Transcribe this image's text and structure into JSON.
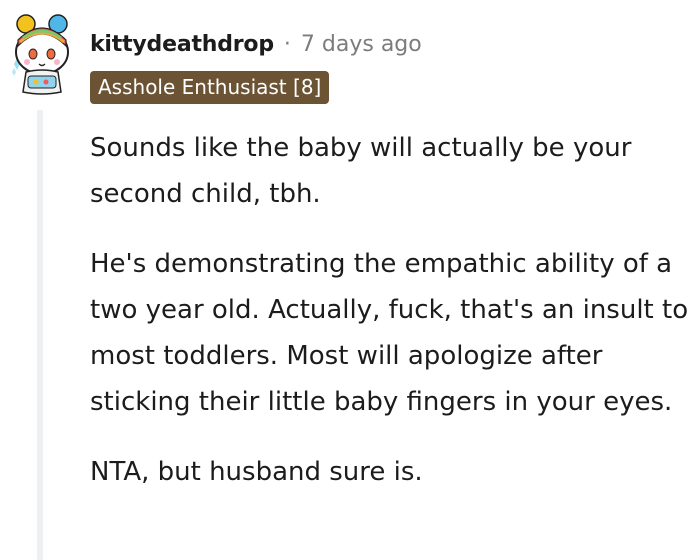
{
  "comment": {
    "username": "kittydeathdrop",
    "separator": "·",
    "timestamp": "7 days ago",
    "flair": "Asshole Enthusiast [8]",
    "paragraphs": [
      "Sounds like the baby will actually be your second child, tbh.",
      "He's demonstrating the empathic ability of a two year old. Actually, fuck, that's an insult to most toddlers. Most will apologize after sticking their little baby fingers in your eyes.",
      "NTA, but husband sure is."
    ]
  },
  "colors": {
    "flair_background": "#6b5334",
    "thread_line": "#edeff1",
    "meta_text": "#7c7c7c"
  },
  "icons": {
    "avatar": "snoo-avatar-icon"
  }
}
